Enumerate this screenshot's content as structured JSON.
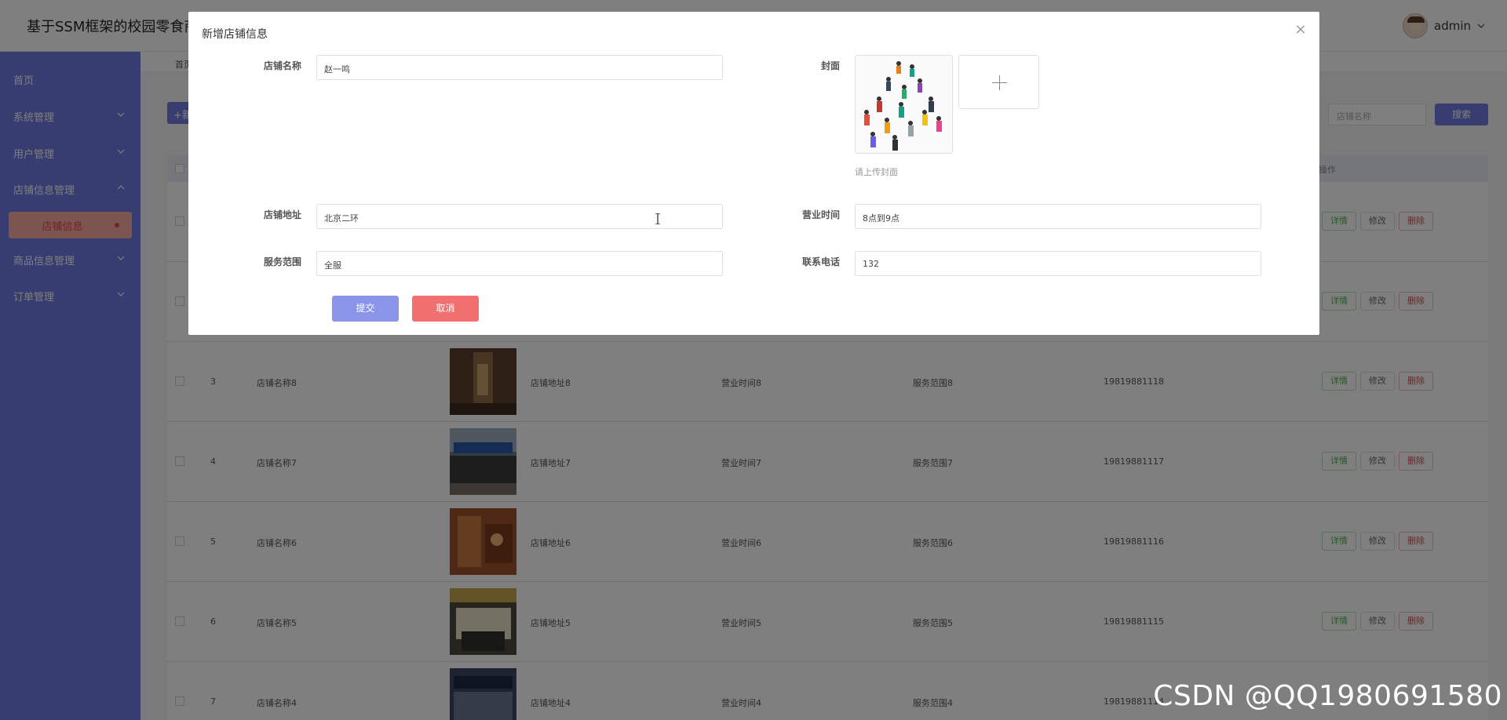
{
  "app": {
    "title": "基于SSM框架的校园零食商",
    "user_name": "admin"
  },
  "sidebar": {
    "items": [
      {
        "label": "首页"
      },
      {
        "label": "系统管理"
      },
      {
        "label": "用户管理"
      },
      {
        "label": "店铺信息管理"
      },
      {
        "label": "商品信息管理"
      },
      {
        "label": "订单管理"
      }
    ],
    "active_sub": "店铺信息"
  },
  "breadcrumb": "首页",
  "toolbar": {
    "add_label": "+新",
    "search_placeholder": "店铺名称",
    "search_label": "搜索"
  },
  "table": {
    "header_last": "操作",
    "rows": [
      {
        "no": "3",
        "name": "店铺名称8",
        "address": "店铺地址8",
        "hours": "营业时间8",
        "scope": "服务范围8",
        "phone": "19819881118"
      },
      {
        "no": "4",
        "name": "店铺名称7",
        "address": "店铺地址7",
        "hours": "营业时间7",
        "scope": "服务范围7",
        "phone": "19819881117"
      },
      {
        "no": "5",
        "name": "店铺名称6",
        "address": "店铺地址6",
        "hours": "营业时间6",
        "scope": "服务范围6",
        "phone": "19819881116"
      },
      {
        "no": "6",
        "name": "店铺名称5",
        "address": "店铺地址5",
        "hours": "营业时间5",
        "scope": "服务范围5",
        "phone": "19819881115"
      },
      {
        "no": "7",
        "name": "店铺名称4",
        "address": "店铺地址4",
        "hours": "营业时间4",
        "scope": "服务范围4",
        "phone": "19819881114"
      }
    ],
    "actions": {
      "detail": "详情",
      "edit": "修改",
      "delete": "删除"
    }
  },
  "dialog": {
    "title": "新增店铺信息",
    "fields": {
      "name_label": "店铺名称",
      "name_value": "赵一鸣",
      "cover_label": "封面",
      "cover_hint": "请上传封面",
      "address_label": "店铺地址",
      "address_value": "北京二环",
      "hours_label": "营业时间",
      "hours_value": "8点到9点",
      "scope_label": "服务范围",
      "scope_value": "全服",
      "phone_label": "联系电话",
      "phone_value": "132"
    },
    "submit_label": "提交",
    "cancel_label": "取消"
  },
  "watermark": "CSDN @QQ1980691580"
}
